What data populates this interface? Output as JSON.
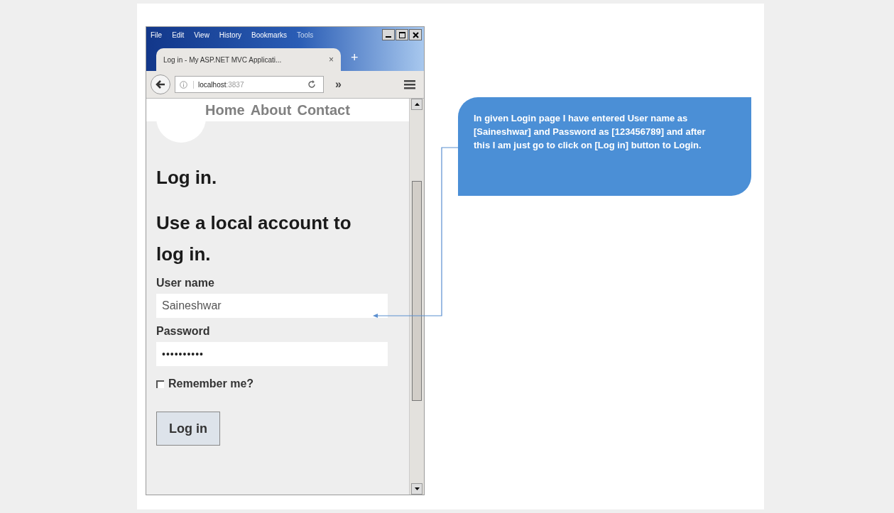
{
  "browser": {
    "menu": [
      "File",
      "Edit",
      "View",
      "History",
      "Bookmarks",
      "Tools"
    ],
    "tab": {
      "title": "Log in - My ASP.NET MVC Applicati...",
      "close": "×",
      "new_tab": "+"
    },
    "url": {
      "host": "localhost",
      "port": ":3837"
    },
    "toolbar": {
      "overflow": "»"
    }
  },
  "page": {
    "nav": [
      "Home",
      "About",
      "Contact"
    ],
    "title": "Log in.",
    "subtitle": "Use a local account to log in.",
    "fields": [
      {
        "label": "User name",
        "value": "Saineshwar"
      },
      {
        "label": "Password",
        "value": "••••••••••"
      }
    ],
    "remember": {
      "label": "Remember me?",
      "checked": false
    },
    "button": "Log in"
  },
  "callout": {
    "text": "In given Login page I have entered User name as [Saineshwar] and Password as [123456789] and after this I am just go to click on [Log in] button to Login."
  }
}
